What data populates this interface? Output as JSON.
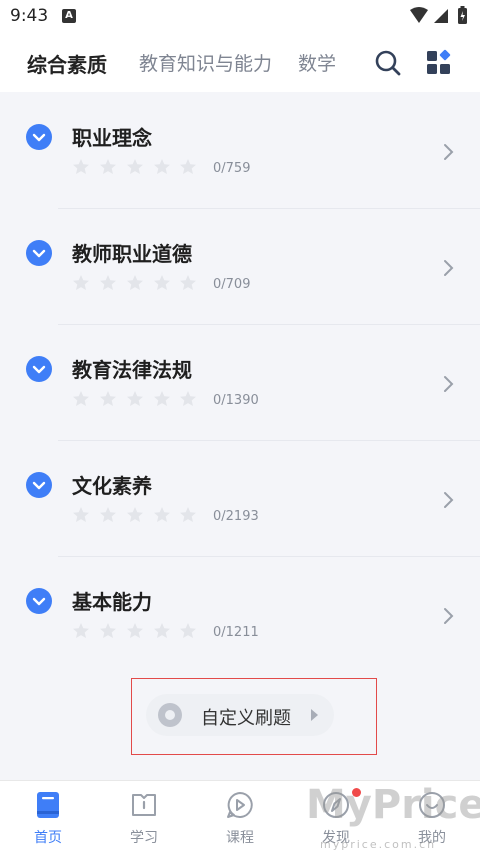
{
  "status": {
    "time": "9:43",
    "badge": "A"
  },
  "tabs": [
    {
      "label": "综合素质"
    },
    {
      "label": "教育知识与能力"
    },
    {
      "label": "数学"
    }
  ],
  "topbar_icons": [
    "search-icon",
    "grid-menu-icon"
  ],
  "subjects": [
    {
      "title": "职业理念",
      "progress": "0/759",
      "stars": 0
    },
    {
      "title": "教师职业道德",
      "progress": "0/709",
      "stars": 0
    },
    {
      "title": "教育法律法规",
      "progress": "0/1390",
      "stars": 0
    },
    {
      "title": "文化素养",
      "progress": "0/2193",
      "stars": 0
    },
    {
      "title": "基本能力",
      "progress": "0/1211",
      "stars": 0
    }
  ],
  "custom_practice": {
    "label": "自定义刷题"
  },
  "bottom_nav": [
    {
      "label": "首页",
      "icon": "book-icon"
    },
    {
      "label": "学习",
      "icon": "study-icon"
    },
    {
      "label": "课程",
      "icon": "video-icon"
    },
    {
      "label": "发现",
      "icon": "compass-icon"
    },
    {
      "label": "我的",
      "icon": "profile-icon"
    }
  ],
  "watermark": {
    "big": "MyPrice",
    "small": "myprice.com.cn"
  },
  "colors": {
    "accent": "#3f7ef7",
    "notify": "#f04a4a",
    "highlight": "#e24a4a"
  }
}
